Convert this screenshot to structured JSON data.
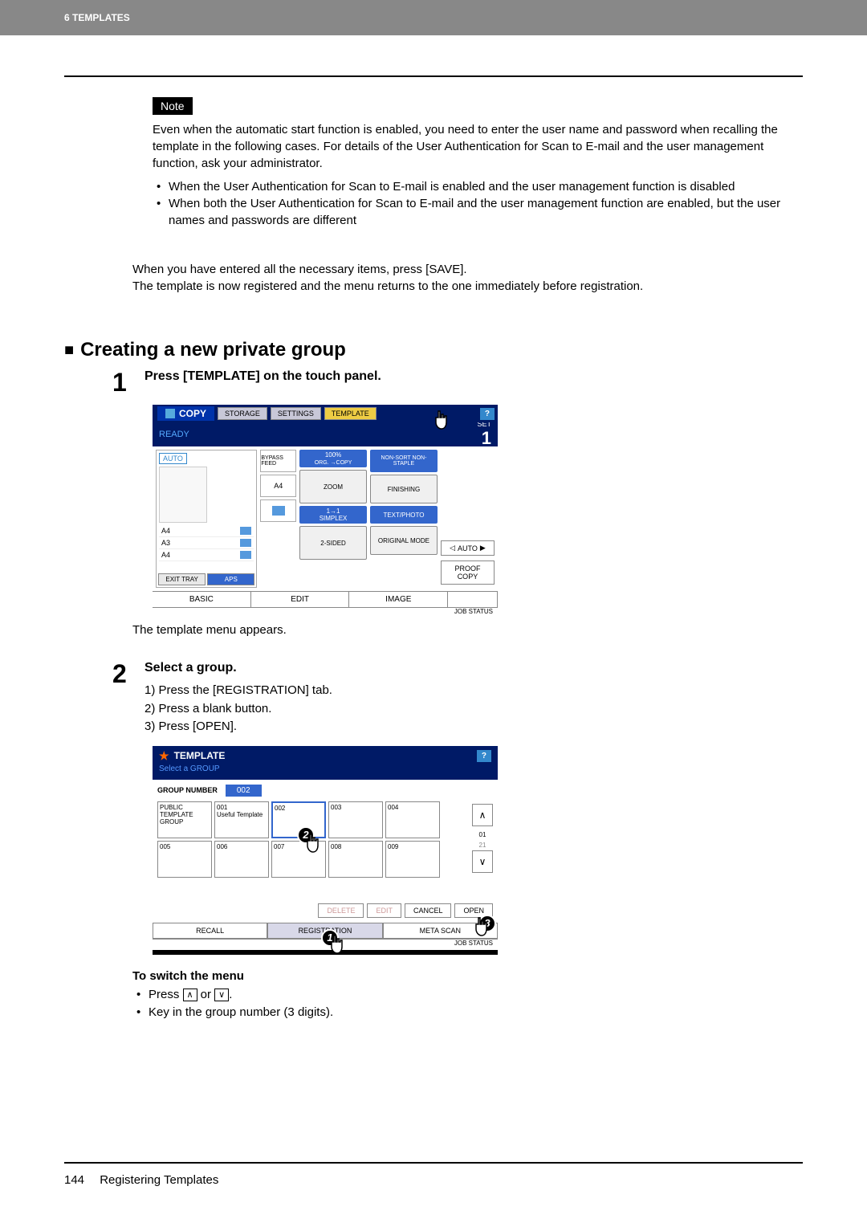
{
  "header": {
    "chapter": "6 TEMPLATES"
  },
  "note": {
    "badge": "Note",
    "text": "Even when the automatic start function is enabled, you need to enter the user name and password when recalling the template in the following cases. For details of the User Authentication for Scan to E-mail and the user management function, ask your administrator.",
    "bullets": [
      "When the User Authentication for Scan to E-mail is enabled and the user management function is disabled",
      "When both the User Authentication for Scan to E-mail and the user management function are enabled, but the user names and passwords are different"
    ]
  },
  "para1": "When you have entered all the necessary items, press [SAVE].",
  "para2": "The template is now registered and the menu returns to the one immediately before registration.",
  "section_heading": "Creating a new private group",
  "step1": {
    "num": "1",
    "title": "Press [TEMPLATE] on the touch panel.",
    "after": "The template menu appears."
  },
  "step2": {
    "num": "2",
    "title": "Select a group.",
    "items": [
      "1)  Press the [REGISTRATION] tab.",
      "2)  Press a blank button.",
      "3)  Press [OPEN]."
    ]
  },
  "panel1": {
    "copy": "COPY",
    "tabs": {
      "storage": "STORAGE",
      "settings": "SETTINGS",
      "template": "TEMPLATE"
    },
    "help": "?",
    "ready": "READY",
    "set": "SET",
    "count": "1",
    "auto": "AUTO",
    "size_a4": "A4",
    "size_a3": "A3",
    "size_a4b": "A4",
    "exit": "EXIT TRAY",
    "aps": "APS",
    "bypass": "BYPASS FEED",
    "mid_a4": "A4",
    "zoom_pct": "100%",
    "zoom_sub": "ORG.  →COPY",
    "zoom": "ZOOM",
    "simplex_top": "1→1",
    "simplex": "SIMPLEX",
    "twosided": "2-SIDED",
    "nonsort": "NON-SORT NON-STAPLE",
    "finishing": "FINISHING",
    "textphoto": "TEXT/PHOTO",
    "origmode": "ORIGINAL MODE",
    "auto_btn": "AUTO",
    "proof": "PROOF COPY",
    "btab_basic": "BASIC",
    "btab_edit": "EDIT",
    "btab_image": "IMAGE",
    "job": "JOB STATUS"
  },
  "panel2": {
    "title": "TEMPLATE",
    "sub": "Select a GROUP",
    "help": "?",
    "group_number_label": "GROUP NUMBER",
    "group_number_val": "002",
    "cells": {
      "public": "PUBLIC TEMPLATE GROUP",
      "c001_num": "001",
      "c001_txt": "Useful Template",
      "c002": "002",
      "c003": "003",
      "c004": "004",
      "c005": "005",
      "c006": "006",
      "c007": "007",
      "c008": "008",
      "c009": "009"
    },
    "scroll_up": "∧",
    "scroll_dn": "∨",
    "page_top": "01",
    "page_bot": "21",
    "delete": "DELETE",
    "edit": "EDIT",
    "cancel": "CANCEL",
    "open": "OPEN",
    "recall": "RECALL",
    "registration": "REGISTRATION",
    "metascan": "META SCAN",
    "job": "JOB STATUS"
  },
  "switch_menu": {
    "heading": "To switch the menu",
    "line1a": "Press ",
    "line1b": " or ",
    "line1c": ".",
    "line2": "Key in the group number (3 digits)."
  },
  "footer": {
    "page": "144",
    "title": "Registering Templates"
  }
}
